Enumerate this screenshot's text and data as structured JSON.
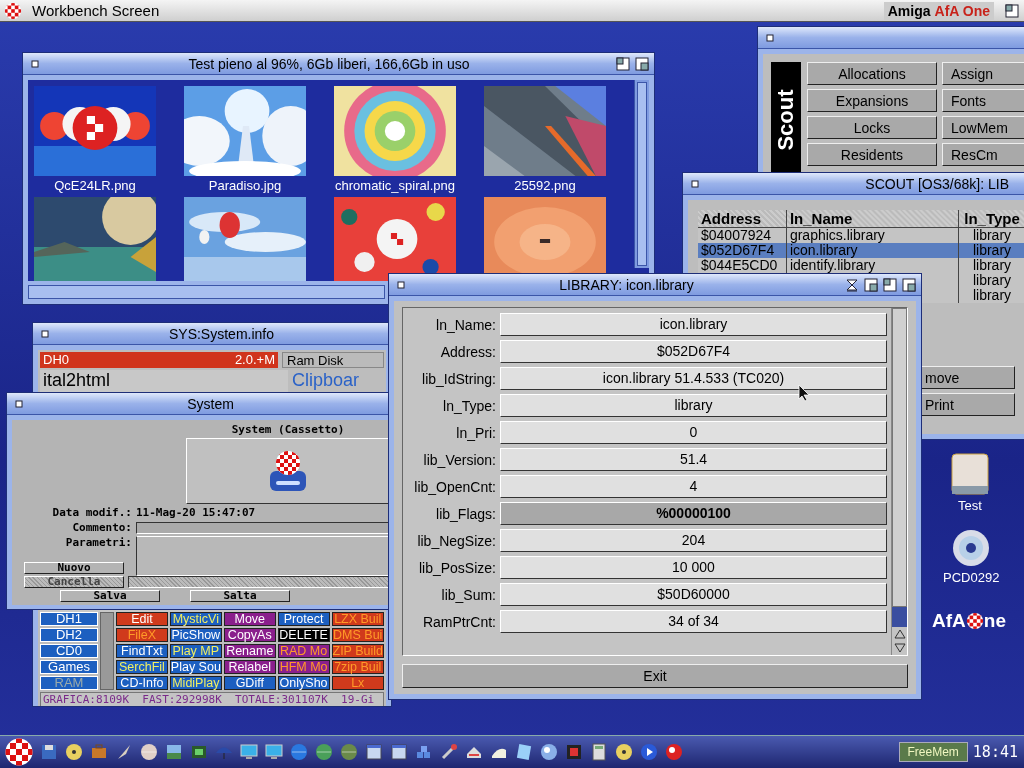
{
  "screen_bar": {
    "title": "Workbench Screen",
    "brand": "Amiga",
    "brand_accent": "AfA One"
  },
  "drawer_window": {
    "title": "Test  pieno al 96%, 6Gb liberi, 166,6Gb in uso",
    "icons": [
      {
        "kind": "picture",
        "label": "QcE24LR.png"
      },
      {
        "kind": "picture",
        "label": "Paradiso.jpg"
      },
      {
        "kind": "picture",
        "label": "chromatic_spiral.png"
      },
      {
        "kind": "picture",
        "label": "25592.png"
      },
      {
        "kind": "picture"
      },
      {
        "kind": "picture"
      },
      {
        "kind": "picture"
      },
      {
        "kind": "picture"
      }
    ]
  },
  "scout_window": {
    "side_label": "Scout",
    "buttons": [
      "Allocations",
      "Assign",
      "Expansions",
      "Fonts",
      "Locks",
      "LowMem",
      "Residents",
      "ResCm"
    ]
  },
  "scout_list_window": {
    "title": "SCOUT [OS3/68k]: LIB",
    "columns": [
      "Address",
      "ln_Name",
      "ln_Type"
    ],
    "rows": [
      {
        "address": "$04007924",
        "name": "graphics.library",
        "type": "library",
        "selected": false
      },
      {
        "address": "$052D67F4",
        "name": "icon.library",
        "type": "library",
        "selected": true
      },
      {
        "address": "$044E5CD0",
        "name": "identify.library",
        "type": "library",
        "selected": false
      },
      {
        "type": "library",
        "selected": false
      },
      {
        "type": "library",
        "selected": false
      }
    ],
    "buttons": [
      "move",
      "Print"
    ]
  },
  "sysinfo_window": {
    "title": "SYS:System.info",
    "device": {
      "name": "DH0",
      "info": "2.0.+M"
    },
    "volume": "Ram Disk",
    "list_item": "ital2html",
    "volume_item": "Clipboar",
    "devices": [
      {
        "label": "DH1",
        "disabled": false
      },
      {
        "label": "DH2",
        "disabled": false
      },
      {
        "label": "CD0",
        "disabled": false
      },
      {
        "label": "Games",
        "disabled": false
      },
      {
        "label": "RAM",
        "disabled": true
      }
    ],
    "buttons": [
      {
        "label": "Edit",
        "color": "#d03a1c",
        "kind": "white"
      },
      {
        "label": "MysticVi",
        "color": "#1c5fc0",
        "kind": "yellow"
      },
      {
        "label": "Move",
        "color": "#8a1f8c",
        "kind": "white"
      },
      {
        "label": "Protect",
        "color": "#1c5fc0",
        "kind": "white"
      },
      {
        "label": "LZX Buil",
        "color": "#d03a1c",
        "kind": "orange"
      },
      {
        "label": "FileX",
        "color": "#d03a1c",
        "kind": "orange"
      },
      {
        "label": "PicShow",
        "color": "#1c5fc0",
        "kind": "white"
      },
      {
        "label": "CopyAs",
        "color": "#8a1f8c",
        "kind": "white"
      },
      {
        "label": "DELETE",
        "color": "#000000",
        "kind": "white"
      },
      {
        "label": "DMS Bui",
        "color": "#d03a1c",
        "kind": "orange"
      },
      {
        "label": "FindTxt",
        "color": "#1c5fc0",
        "kind": "white"
      },
      {
        "label": "Play MP",
        "color": "#1c5fc0",
        "kind": "yellow"
      },
      {
        "label": "Rename",
        "color": "#8a1f8c",
        "kind": "white"
      },
      {
        "label": "RAD Mo",
        "color": "#8a1f8c",
        "kind": "orange"
      },
      {
        "label": "ZIP Build",
        "color": "#d03a1c",
        "kind": "orange"
      },
      {
        "label": "SerchFil",
        "color": "#1c5fc0",
        "kind": "yellow"
      },
      {
        "label": "Play Sou",
        "color": "#1c5fc0",
        "kind": "white"
      },
      {
        "label": "Relabel",
        "color": "#8a1f8c",
        "kind": "white"
      },
      {
        "label": "HFM Mo",
        "color": "#8a1f8c",
        "kind": "orange"
      },
      {
        "label": "7zip Buil",
        "color": "#d03a1c",
        "kind": "orange"
      },
      {
        "label": "CD-Info",
        "color": "#1c5fc0",
        "kind": "white"
      },
      {
        "label": "MidiPlay",
        "color": "#1c5fc0",
        "kind": "yellow"
      },
      {
        "label": "GDiff",
        "color": "#1c5fc0",
        "kind": "white"
      },
      {
        "label": "OnlySho",
        "color": "#1c5fc0",
        "kind": "white"
      },
      {
        "label": "Lx",
        "color": "#d03a1c",
        "kind": "orange"
      }
    ],
    "status": "GRAFICA:8109K  FAST:292998K  TOTALE:301107K  19-Gi"
  },
  "system_window": {
    "title": "System",
    "icon_caption": "System (Cassetto)",
    "date_label": "Data modif.:",
    "date_value": "11-Mag-20 15:47:07",
    "comment_label": "Commento:",
    "params_label": "Parametri:",
    "buttons": [
      {
        "label": "Nuovo",
        "disabled": false
      },
      {
        "label": "Cancella",
        "disabled": true
      }
    ],
    "footer_buttons": [
      "Salva",
      "Salta"
    ]
  },
  "library_window": {
    "title": "LIBRARY: icon.library",
    "fields": [
      {
        "label": "ln_Name:",
        "value": "icon.library",
        "selected": false
      },
      {
        "label": "Address:",
        "value": "$052D67F4",
        "selected": false
      },
      {
        "label": "lib_IdString:",
        "value": "icon.library 51.4.533 (TC020)",
        "selected": false
      },
      {
        "label": "ln_Type:",
        "value": "library",
        "selected": false
      },
      {
        "label": "ln_Pri:",
        "value": "0",
        "selected": false
      },
      {
        "label": "lib_Version:",
        "value": "51.4",
        "selected": false
      },
      {
        "label": "lib_OpenCnt:",
        "value": "4",
        "selected": false
      },
      {
        "label": "lib_Flags:",
        "value": "%00000100",
        "selected": true
      },
      {
        "label": "lib_NegSize:",
        "value": "204",
        "selected": false
      },
      {
        "label": "lib_PosSize:",
        "value": "10 000",
        "selected": false
      },
      {
        "label": "lib_Sum:",
        "value": "$50D60000",
        "selected": false
      },
      {
        "label": "RamPtrCnt:",
        "value": "34 of 34",
        "selected": false
      }
    ],
    "exit": "Exit"
  },
  "desktop_icons": [
    {
      "label": "Test",
      "kind": "drive"
    },
    {
      "label": "PCD0292",
      "kind": "cd"
    }
  ],
  "logo": {
    "before": "AfA",
    "after": "ne"
  },
  "taskbar": {
    "gauge": "FreeMem",
    "clock": "18:41"
  }
}
